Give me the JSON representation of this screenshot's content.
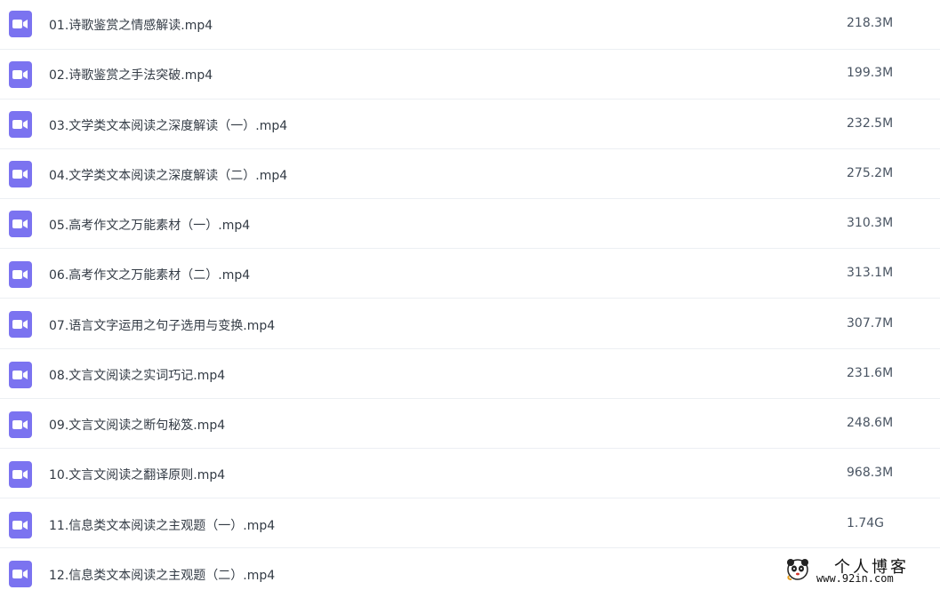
{
  "colors": {
    "video_icon_bg": "#7b73f0",
    "row_divider": "#eceff3"
  },
  "file_icon": "video-camera-icon",
  "files": [
    {
      "name": "01.诗歌鉴赏之情感解读.mp4",
      "size": "218.3M"
    },
    {
      "name": "02.诗歌鉴赏之手法突破.mp4",
      "size": "199.3M"
    },
    {
      "name": "03.文学类文本阅读之深度解读（一）.mp4",
      "size": "232.5M"
    },
    {
      "name": "04.文学类文本阅读之深度解读（二）.mp4",
      "size": "275.2M"
    },
    {
      "name": "05.高考作文之万能素材（一）.mp4",
      "size": "310.3M"
    },
    {
      "name": "06.高考作文之万能素材（二）.mp4",
      "size": "313.1M"
    },
    {
      "name": "07.语言文字运用之句子选用与变换.mp4",
      "size": "307.7M"
    },
    {
      "name": "08.文言文阅读之实词巧记.mp4",
      "size": "231.6M"
    },
    {
      "name": "09.文言文阅读之断句秘笈.mp4",
      "size": "248.6M"
    },
    {
      "name": "10.文言文阅读之翻译原则.mp4",
      "size": "968.3M"
    },
    {
      "name": "11.信息类文本阅读之主观题（一）.mp4",
      "size": "1.74G"
    },
    {
      "name": "12.信息类文本阅读之主观题（二）.mp4",
      "size": ""
    }
  ],
  "watermark": {
    "title": "个人博客",
    "url": "www.92in.com"
  }
}
